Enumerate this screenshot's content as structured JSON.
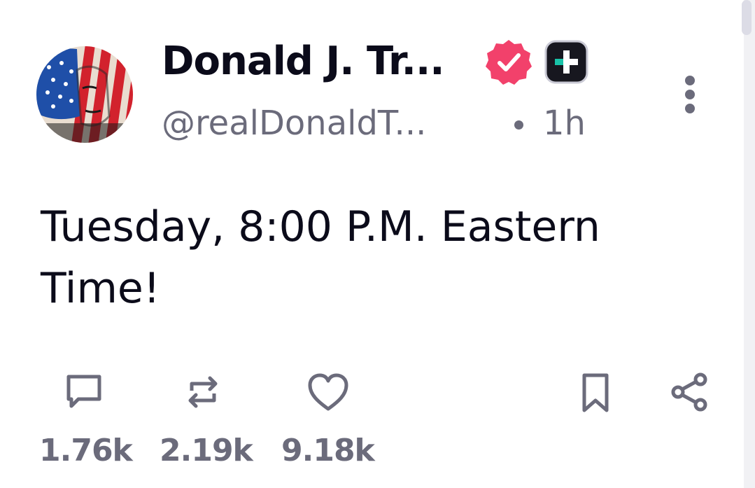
{
  "post": {
    "display_name": "Donald J. Tr...",
    "handle": "@realDonaldT...",
    "separator": "•",
    "time": "1h",
    "body": "Tuesday, 8:00 P.M. Eastern Time!",
    "verified_color": "#f2416b",
    "plus_badge_color": "#17171f",
    "plus_badge_accent": "#19c3a8"
  },
  "actions": {
    "reply_count": "1.76k",
    "repost_count": "2.19k",
    "like_count": "9.18k"
  },
  "colors": {
    "text_primary": "#0b0b1a",
    "text_secondary": "#6b6b7b",
    "icon": "#6b6b7b"
  }
}
